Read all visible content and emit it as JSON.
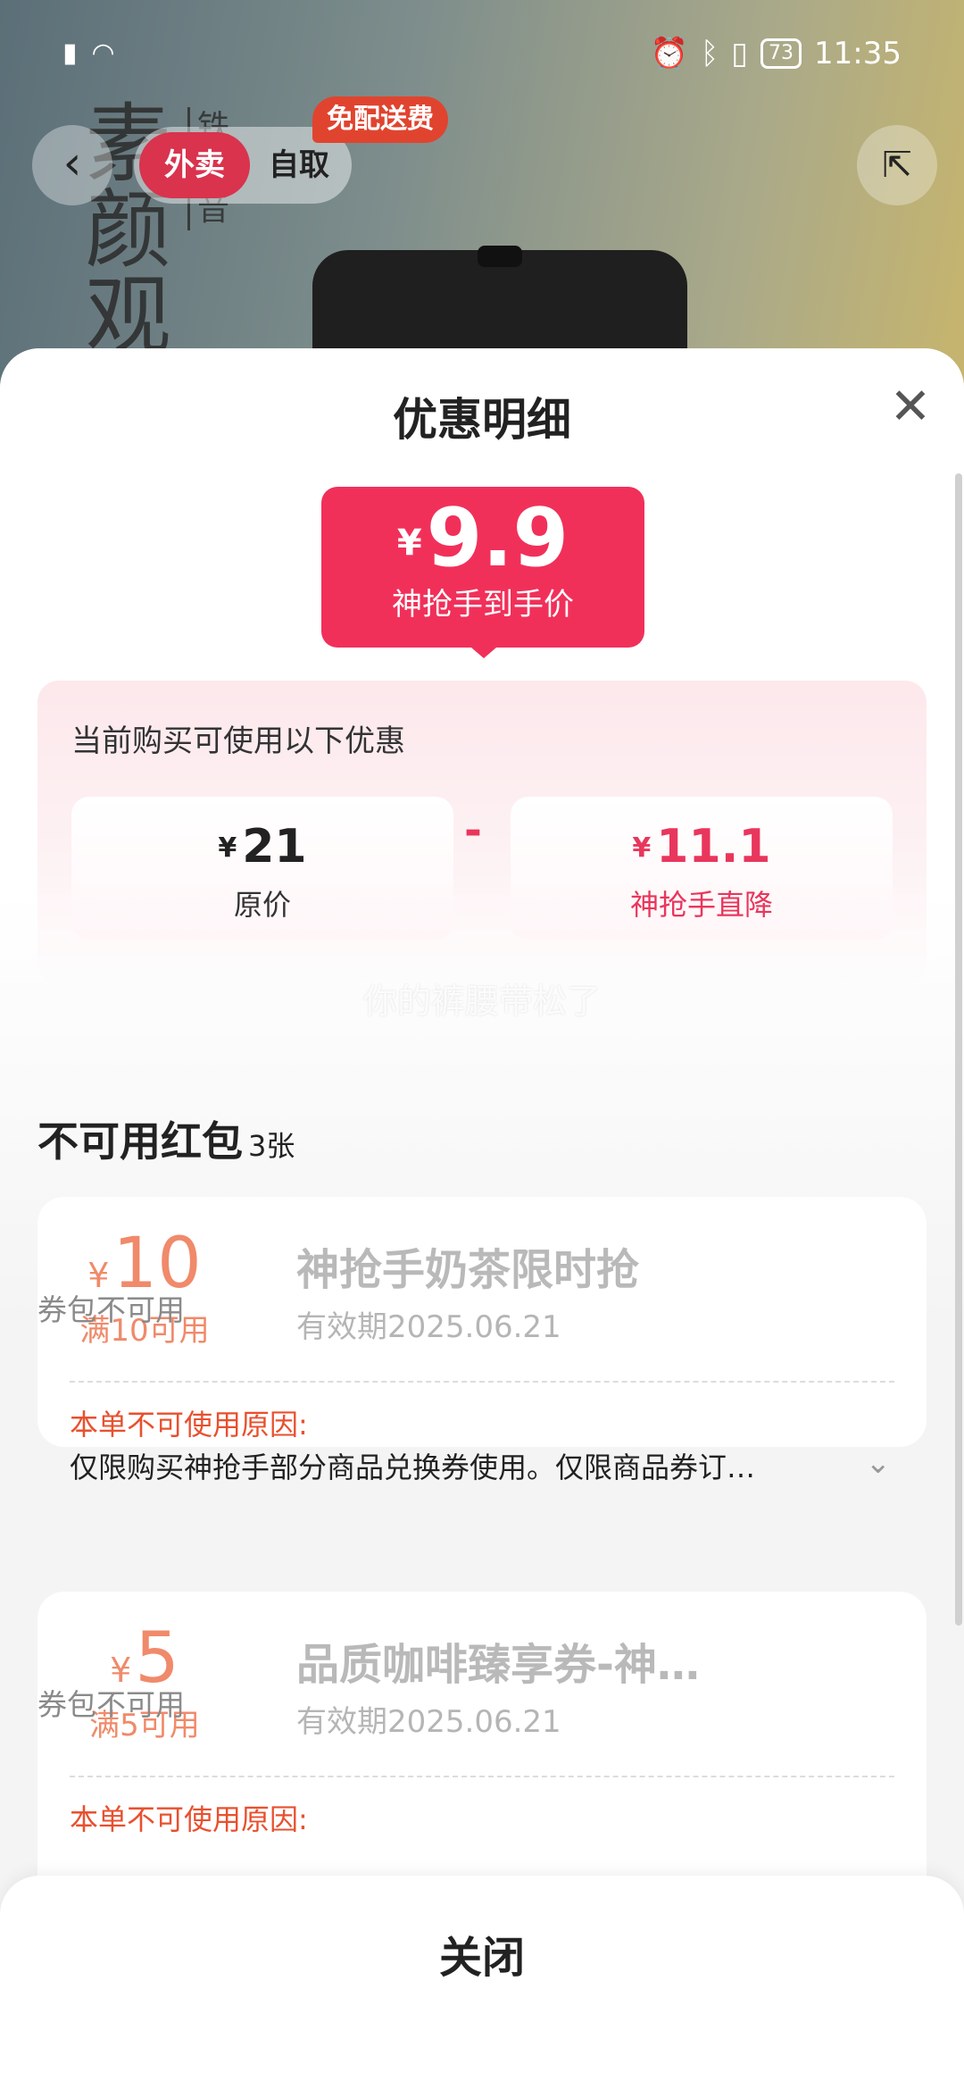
{
  "status_bar": {
    "time": "11:35",
    "battery": "73",
    "icons_left": [
      "alert-icon",
      "wifi-icon"
    ],
    "icons_right": [
      "alarm-icon",
      "bluetooth-icon",
      "vibrate-icon"
    ]
  },
  "background": {
    "poster_text": "素颜观",
    "poster_sub": "铁观音"
  },
  "header": {
    "mode_delivery": "外卖",
    "mode_pickup": "自取",
    "free_delivery_tag": "免配送费"
  },
  "sheet": {
    "title": "优惠明细",
    "final_price": {
      "currency": "¥",
      "amount": "9.9",
      "label": "神抢手到手价"
    },
    "promo": {
      "caption": "当前购买可使用以下优惠",
      "original": {
        "currency": "¥",
        "amount": "21",
        "label": "原价"
      },
      "operator": "-",
      "discount": {
        "currency": "¥",
        "amount": "11.1",
        "label": "神抢手直降"
      }
    },
    "watermark": "你的裤腰带松了",
    "unavailable": {
      "title": "不可用红包",
      "count": "3张",
      "coupons": [
        {
          "currency": "¥",
          "amount": "10",
          "condition": "满10可用",
          "name": "神抢手奶茶限时抢",
          "valid": "有效期2025.06.21",
          "status": "券包不可用",
          "reason_title": "本单不可使用原因:",
          "reason": "仅限购买神抢手部分商品兑换券使用。仅限商品券订…"
        },
        {
          "currency": "¥",
          "amount": "5",
          "condition": "满5可用",
          "name": "品质咖啡臻享券-神…",
          "valid": "有效期2025.06.21",
          "status": "券包不可用",
          "reason_title": "本单不可使用原因:"
        }
      ]
    },
    "close_button": "关闭"
  },
  "colors": {
    "accent": "#f1305a",
    "delivery_pill": "#d9334e",
    "coupon_amount": "#f08a6a",
    "reason_title": "#e8502e"
  }
}
